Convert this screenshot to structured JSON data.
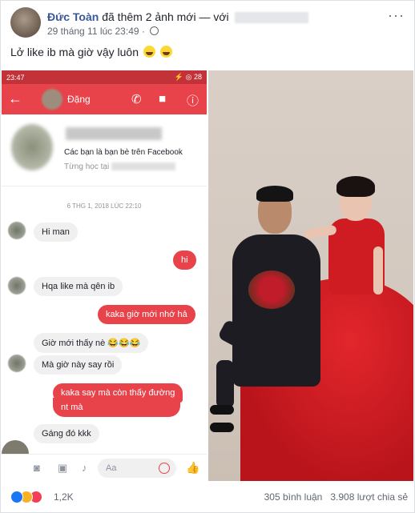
{
  "post": {
    "author": "Đức Toàn",
    "action": "đã thêm 2 ảnh mới — với",
    "timestamp": "29 tháng 11 lúc 23:49",
    "more": "···",
    "caption": "Lở like ib mà giờ vậy luôn"
  },
  "phone": {
    "status_time": "23:47",
    "status_right": "⚡ ◎ 28",
    "contact_name": "Đặng",
    "friends_text": "Các bạn là bạn bè trên Facebook",
    "studied_text": "Từng học tại",
    "date_divider": "6 THG 1, 2018 LÚC 22:10",
    "messages": [
      {
        "dir": "in",
        "text": "Hi man"
      },
      {
        "dir": "out",
        "text": "hi"
      },
      {
        "dir": "in",
        "text": "Hqa like mà qên ib"
      },
      {
        "dir": "out",
        "text": "kaka giờ mới nhớ hả"
      },
      {
        "dir": "in",
        "text": "Giờ mới thấy nè 😂😂😂"
      },
      {
        "dir": "in",
        "text": "Mà giờ này say      rồi"
      },
      {
        "dir": "out",
        "text": "kaka say mà còn thấy đường"
      },
      {
        "dir": "out",
        "text": "nt mà"
      },
      {
        "dir": "in",
        "text": "Gáng đó kkk"
      }
    ],
    "compose_placeholder": "Aa"
  },
  "footer": {
    "reactions_count": "1,2K",
    "comments": "305 bình luận",
    "shares": "3.908 lượt chia sẻ"
  },
  "colors": {
    "messenger_red": "#e8434a",
    "link_blue": "#385898",
    "dress_red": "#c8141c"
  }
}
